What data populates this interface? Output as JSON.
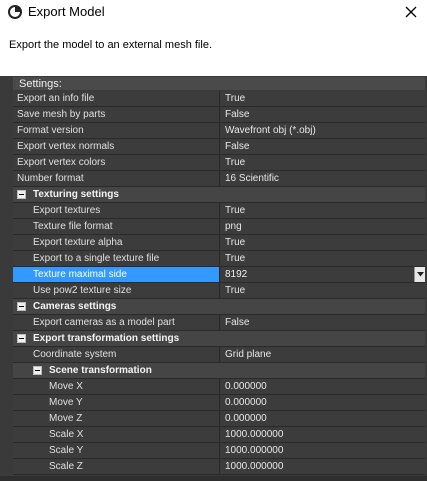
{
  "window": {
    "title": "Export Model",
    "description": "Export the model to an external mesh file."
  },
  "settings_title": "Settings:",
  "rows": [
    {
      "type": "prop",
      "indent": 0,
      "name": "Export an info file",
      "value": "True"
    },
    {
      "type": "prop",
      "indent": 0,
      "name": "Save mesh by parts",
      "value": "False"
    },
    {
      "type": "prop",
      "indent": 0,
      "name": "Format version",
      "value": "Wavefront obj (*.obj)"
    },
    {
      "type": "prop",
      "indent": 0,
      "name": "Export vertex normals",
      "value": "False"
    },
    {
      "type": "prop",
      "indent": 0,
      "name": "Export vertex colors",
      "value": "True"
    },
    {
      "type": "prop",
      "indent": 0,
      "name": "Number format",
      "value": "16 Scientific"
    },
    {
      "type": "group",
      "indent": 0,
      "name": "Texturing settings"
    },
    {
      "type": "prop",
      "indent": 1,
      "name": "Export textures",
      "value": "True"
    },
    {
      "type": "prop",
      "indent": 1,
      "name": "Texture file format",
      "value": "png"
    },
    {
      "type": "prop",
      "indent": 1,
      "name": "Export texture alpha",
      "value": "True"
    },
    {
      "type": "prop",
      "indent": 1,
      "name": "Export to a single texture file",
      "value": "True"
    },
    {
      "type": "prop",
      "indent": 1,
      "name": "Texture maximal side",
      "value": "8192",
      "selected": true,
      "dropdown": true
    },
    {
      "type": "prop",
      "indent": 1,
      "name": "Use pow2 texture size",
      "value": "True"
    },
    {
      "type": "group",
      "indent": 0,
      "name": "Cameras settings"
    },
    {
      "type": "prop",
      "indent": 1,
      "name": "Export cameras as a model part",
      "value": "False"
    },
    {
      "type": "group",
      "indent": 0,
      "name": "Export transformation settings"
    },
    {
      "type": "prop",
      "indent": 1,
      "name": "Coordinate system",
      "value": "Grid plane"
    },
    {
      "type": "group",
      "indent": 1,
      "name": "Scene transformation"
    },
    {
      "type": "prop",
      "indent": 2,
      "name": "Move X",
      "value": "0.000000"
    },
    {
      "type": "prop",
      "indent": 2,
      "name": "Move Y",
      "value": "0.000000"
    },
    {
      "type": "prop",
      "indent": 2,
      "name": "Move Z",
      "value": "0.000000"
    },
    {
      "type": "prop",
      "indent": 2,
      "name": "Scale X",
      "value": "1000.000000"
    },
    {
      "type": "prop",
      "indent": 2,
      "name": "Scale Y",
      "value": "1000.000000"
    },
    {
      "type": "prop",
      "indent": 2,
      "name": "Scale Z",
      "value": "1000.000000"
    }
  ],
  "icons": {
    "app": "app-logo-icon",
    "close": "close-icon",
    "collapse": "collapse-minus-icon",
    "dropdown": "chevron-down-icon"
  },
  "colors": {
    "panel_bg": "#3a3a3a",
    "cell_bg": "#3c3c3c",
    "group_bg": "#454545",
    "selection": "#3399ff"
  }
}
